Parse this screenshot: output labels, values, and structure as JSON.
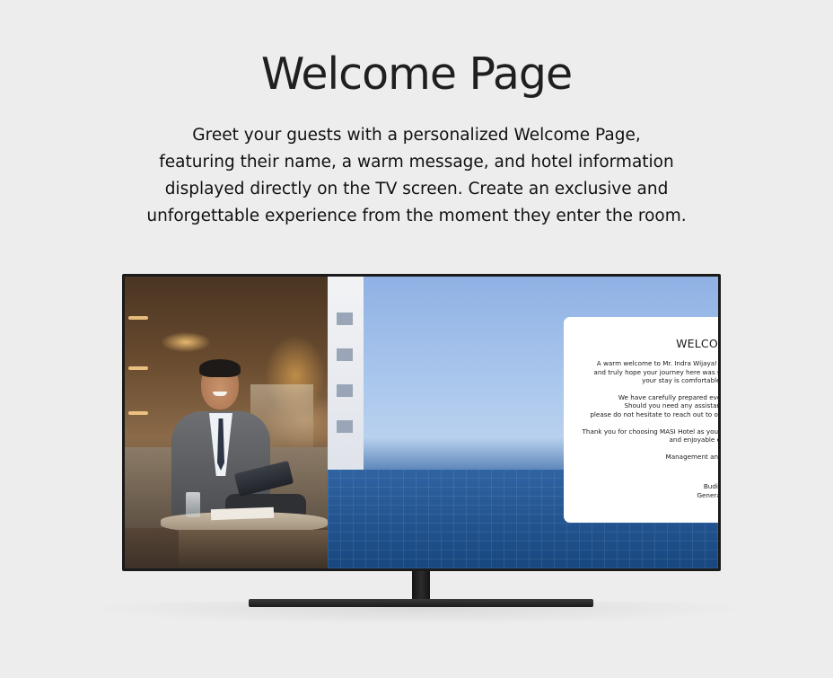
{
  "hero": {
    "title": "Welcome Page",
    "description_lines": [
      "Greet your guests with a personalized Welcome Page,",
      "featuring their name, a warm message, and hotel information",
      "displayed directly on the TV screen. Create an exclusive and",
      "unforgettable experience from the moment they enter the room."
    ]
  },
  "tv_screen": {
    "card": {
      "title": "WELCOME HOME",
      "paragraph1": [
        "A warm welcome to Mr. Indra Wijaya! We are honored to have you as our guest",
        "and truly hope your journey here was smooth. Our team is dedicated to ensuring",
        "your stay is comfortable, relaxing, and memorable."
      ],
      "paragraph2": [
        "We have carefully prepared everything to make you feel at home.",
        "Should you need any assistance or have any special requests,",
        "please do not hesitate to reach out to our team. Your satisfaction is our top priority."
      ],
      "paragraph3": [
        "Thank you for choosing MASI Hotel as your place of stay. We hope you have a wonderful",
        "and enjoyable experience with us!"
      ],
      "closing": "Management and staff of MASI Hotel",
      "signature_name": "Budi Hartono",
      "signature_title": "General Manager"
    }
  },
  "colors": {
    "background": "#ededed",
    "tv_frame": "#1b1b1b",
    "card_background": "#ffffff",
    "text": "#1f1f1f"
  }
}
